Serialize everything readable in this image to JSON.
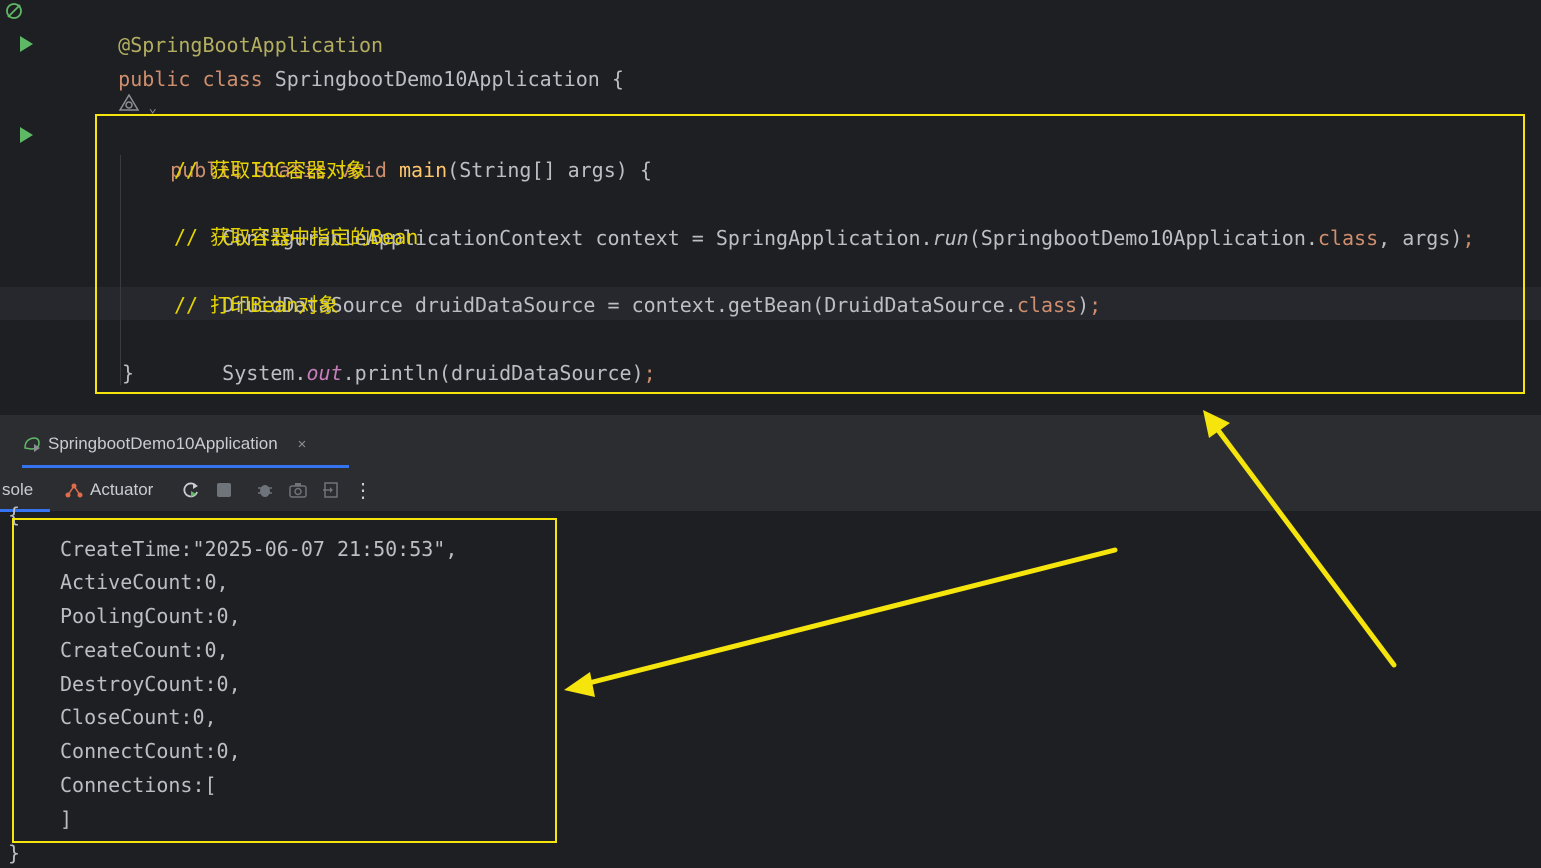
{
  "editor": {
    "annotation": "@SpringBootApplication",
    "class_decl": {
      "kw1": "public",
      "kw2": "class",
      "name": "SpringbootDemo10Application",
      "brace": "{"
    },
    "method_decl": {
      "kw1": "public",
      "kw2": "static",
      "kw3": "void",
      "name": "main",
      "params": "(String[] args) {"
    },
    "comment1": "// 获取IOC容器对象",
    "line_context": {
      "left": "ConfigurableApplicationContext context = SpringApplication.",
      "method": "run",
      "args_start": "(SpringbootDemo10Application.",
      "kw_class": "class",
      "args_end": ", args)",
      "semi": ";"
    },
    "comment2": "// 获取容器中指定的Bean",
    "line_bean": {
      "left": "DruidDataSource druidDataSource = context.getBean(DruidDataSource.",
      "kw_class": "class",
      "end": ")",
      "semi": ";"
    },
    "comment3": "// 打印Bean对象",
    "line_print": {
      "left": "System.",
      "field": "out",
      "right": ".println(druidDataSource)",
      "semi": ";"
    },
    "close_brace": "}"
  },
  "run_window": {
    "tab_label": "SpringbootDemo10Application",
    "tab_close": "×",
    "toolbar": {
      "console_label": "sole",
      "actuator_label": "Actuator"
    }
  },
  "console": {
    "open_brace": "{",
    "lines": [
      "CreateTime:\"2025-06-07 21:50:53\",",
      "ActiveCount:0,",
      "PoolingCount:0,",
      "CreateCount:0,",
      "DestroyCount:0,",
      "CloseCount:0,",
      "ConnectCount:0,",
      "Connections:[",
      "]"
    ],
    "close_brace": "}"
  },
  "colors": {
    "highlight": "#f5e50c",
    "keyword": "#cf8e6d",
    "comment": "#e6d400",
    "run_icon": "#5fb865",
    "accent": "#3574f0"
  }
}
